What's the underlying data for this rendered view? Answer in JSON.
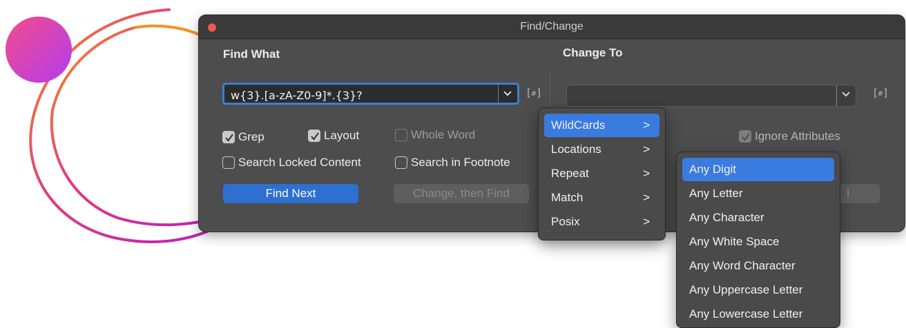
{
  "window": {
    "title": "Find/Change"
  },
  "find": {
    "label": "Find What",
    "value": "w{3}.[a-zA-Z0-9]*.{3}?"
  },
  "change": {
    "label": "Change To",
    "value": ""
  },
  "options": {
    "grep": {
      "label": "Grep",
      "checked": true
    },
    "layout": {
      "label": "Layout",
      "checked": true
    },
    "whole_word": {
      "label": "Whole Word",
      "checked": false
    },
    "search_locked": {
      "label": "Search Locked Content",
      "checked": false
    },
    "search_footnote": {
      "label": "Search in Footnote",
      "checked": false
    },
    "ignore_attributes": {
      "label": "Ignore Attributes",
      "checked": true
    }
  },
  "buttons": {
    "find_next": "Find Next",
    "change_then_find": "Change, then Find",
    "partial": "l"
  },
  "menu": {
    "items": [
      {
        "label": "WildCards",
        "selected": true
      },
      {
        "label": "Locations"
      },
      {
        "label": "Repeat"
      },
      {
        "label": "Match"
      },
      {
        "label": "Posix"
      }
    ],
    "arrow": ">"
  },
  "submenu": {
    "items": [
      {
        "label": "Any Digit",
        "selected": true
      },
      {
        "label": "Any Letter"
      },
      {
        "label": "Any Character"
      },
      {
        "label": "Any White Space"
      },
      {
        "label": "Any Word Character"
      },
      {
        "label": "Any Uppercase Letter"
      },
      {
        "label": "Any Lowercase Letter"
      }
    ]
  },
  "colors": {
    "accent": "#3a7be0",
    "window_bg": "#4d4d4d",
    "close": "#ee5a52",
    "deco_orange": "#f7901e",
    "deco_magenta": "#c21fb8"
  }
}
